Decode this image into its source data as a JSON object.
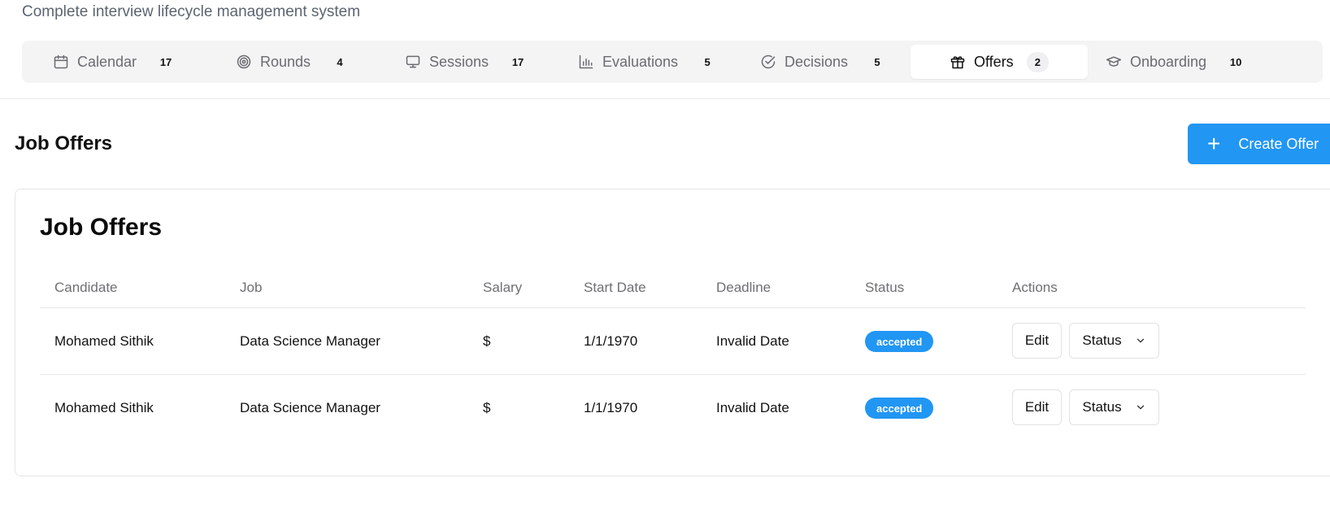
{
  "header": {
    "subtitle": "Complete interview lifecycle management system"
  },
  "tabs": [
    {
      "label": "Calendar",
      "count": "17",
      "icon": "calendar-icon"
    },
    {
      "label": "Rounds",
      "count": "4",
      "icon": "target-icon"
    },
    {
      "label": "Sessions",
      "count": "17",
      "icon": "monitor-icon"
    },
    {
      "label": "Evaluations",
      "count": "5",
      "icon": "bar-chart-icon"
    },
    {
      "label": "Decisions",
      "count": "5",
      "icon": "check-circle-icon"
    },
    {
      "label": "Offers",
      "count": "2",
      "icon": "gift-icon",
      "active": true
    },
    {
      "label": "Onboarding",
      "count": "10",
      "icon": "graduation-cap-icon"
    }
  ],
  "page": {
    "title": "Job Offers",
    "create_label": "Create Offer"
  },
  "card": {
    "title": "Job Offers",
    "columns": [
      "Candidate",
      "Job",
      "Salary",
      "Start Date",
      "Deadline",
      "Status",
      "Actions"
    ],
    "rows": [
      {
        "candidate": "Mohamed Sithik",
        "job": "Data Science Manager",
        "salary": "$",
        "start_date": "1/1/1970",
        "deadline": "Invalid Date",
        "status": "accepted",
        "edit_label": "Edit",
        "status_menu_label": "Status"
      },
      {
        "candidate": "Mohamed Sithik",
        "job": "Data Science Manager",
        "salary": "$",
        "start_date": "1/1/1970",
        "deadline": "Invalid Date",
        "status": "accepted",
        "edit_label": "Edit",
        "status_menu_label": "Status"
      }
    ]
  },
  "colors": {
    "accent": "#2196f3",
    "tab_bg": "#f4f4f5",
    "muted_text": "#6b6b70"
  }
}
